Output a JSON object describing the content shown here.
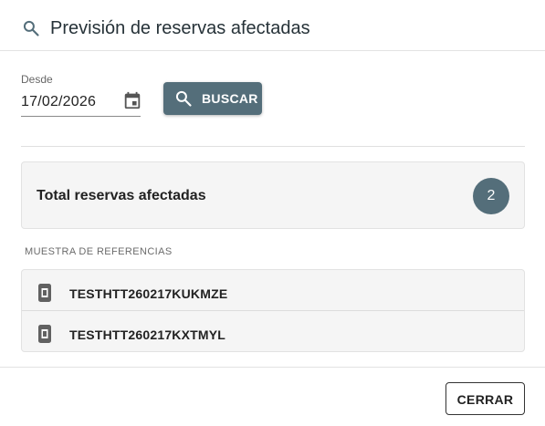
{
  "header": {
    "icon": "search-icon",
    "title": "Previsión de reservas afectadas"
  },
  "date_field": {
    "label": "Desde",
    "value": "17/02/2026",
    "icon": "calendar-icon"
  },
  "search_button": {
    "icon": "search-icon",
    "label": "BUSCAR"
  },
  "total": {
    "label": "Total reservas afectadas",
    "count": "2"
  },
  "references": {
    "section_label": "MUESTRA DE REFERENCIAS",
    "items": [
      {
        "icon": "document-icon",
        "code": "TESTHTT260217KUKMZE"
      },
      {
        "icon": "document-icon",
        "code": "TESTHTT260217KXTMYL"
      }
    ]
  },
  "footer": {
    "close_label": "CERRAR"
  },
  "colors": {
    "accent": "#546e7a",
    "card_background": "#f5f5f5",
    "title_text": "#263238"
  }
}
